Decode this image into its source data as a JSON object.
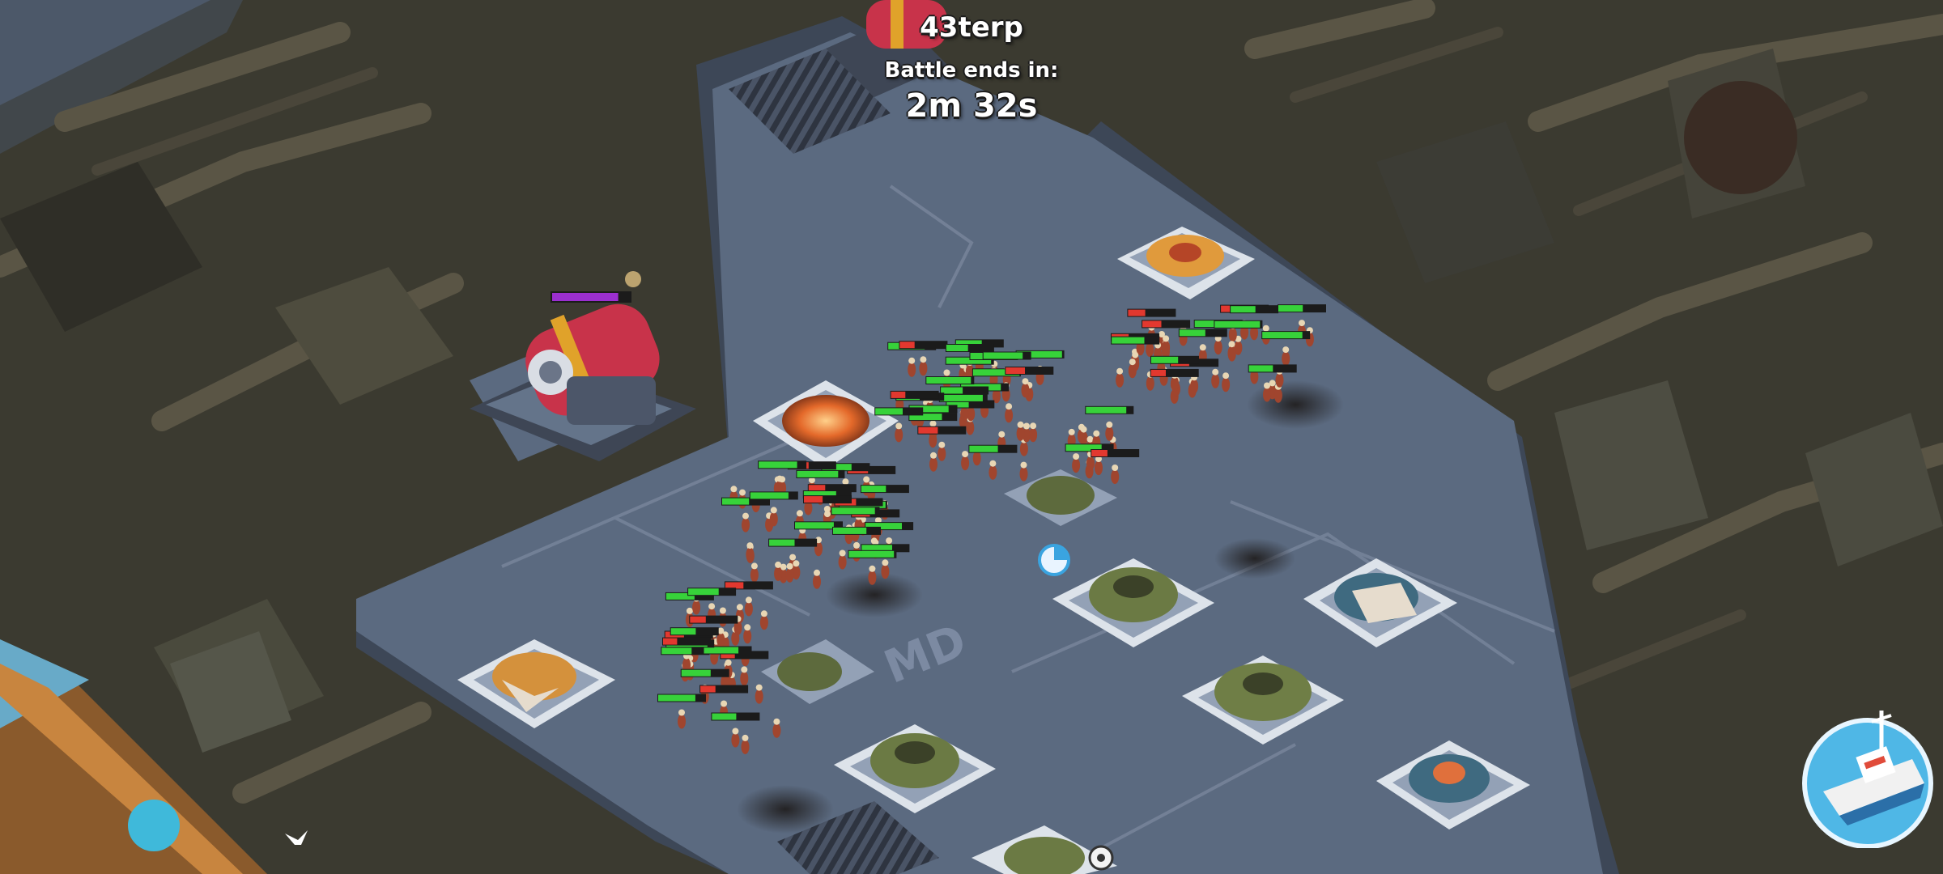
{
  "hud": {
    "player_name": "43terp",
    "battle_label": "Battle ends in:",
    "timer": "2m 32s"
  },
  "map": {
    "ground_label": "MD"
  },
  "colors": {
    "platform": "#5b6a80",
    "platform_edge": "#3d4757",
    "ground": "#3b3a30",
    "health_full": "#37d23a",
    "health_low": "#e2382f",
    "enemy_health": "#9b2fd0",
    "cannon_red": "#c8334a"
  },
  "icons": [
    "cannon-icon",
    "mortar-icon",
    "machine-gun-icon",
    "boat-icon",
    "flare-icon"
  ],
  "enemy_building": {
    "health_fraction": 0.85
  }
}
